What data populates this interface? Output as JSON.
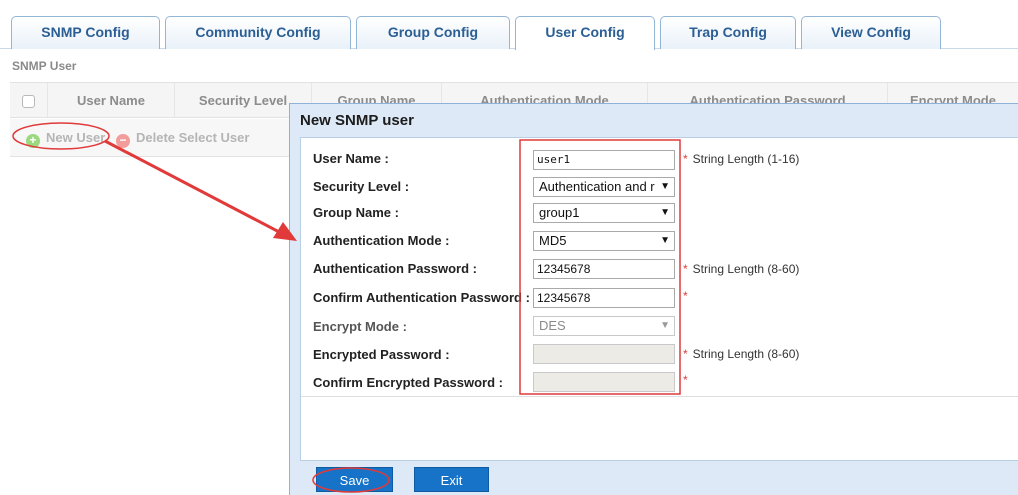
{
  "tabs": [
    {
      "label": "SNMP Config"
    },
    {
      "label": "Community Config"
    },
    {
      "label": "Group Config"
    },
    {
      "label": "User Config",
      "active": true
    },
    {
      "label": "Trap Config"
    },
    {
      "label": "View Config"
    }
  ],
  "section": {
    "title": "SNMP User"
  },
  "grid": {
    "columns": [
      "User Name",
      "Security Level",
      "Group Name",
      "Authentication Mode",
      "Authentication Password",
      "Encrypt Mode"
    ]
  },
  "toolbar": {
    "new_user": "New User",
    "delete_user": "Delete Select User",
    "new_icon": "plus-circle-icon",
    "delete_icon": "minus-circle-icon"
  },
  "dialog": {
    "title": "New SNMP user",
    "fields": {
      "user_name": {
        "label": "User Name :",
        "value": "user1",
        "hint": "String Length (1-16)"
      },
      "security_level": {
        "label": "Security Level :",
        "value": "Authentication and r"
      },
      "group_name": {
        "label": "Group Name :",
        "value": "group1"
      },
      "auth_mode": {
        "label": "Authentication Mode :",
        "value": "MD5"
      },
      "auth_password": {
        "label": "Authentication Password :",
        "value": "12345678",
        "hint": "String Length (8-60)"
      },
      "confirm_auth_password": {
        "label": "Confirm Authentication Password :",
        "value": "12345678"
      },
      "encrypt_mode": {
        "label": "Encrypt Mode :",
        "value": "DES"
      },
      "encrypted_password": {
        "label": "Encrypted Password :",
        "value": "",
        "hint": "String Length (8-60)"
      },
      "confirm_encrypted_password": {
        "label": "Confirm Encrypted Password :",
        "value": ""
      }
    },
    "required_mark": "*",
    "buttons": {
      "save": "Save",
      "exit": "Exit"
    }
  },
  "colors": {
    "tab_text": "#2b5f94",
    "dialog_bg": "#dde9f6",
    "button_bg": "#1673c7",
    "annotation_red": "#e03a3a"
  }
}
